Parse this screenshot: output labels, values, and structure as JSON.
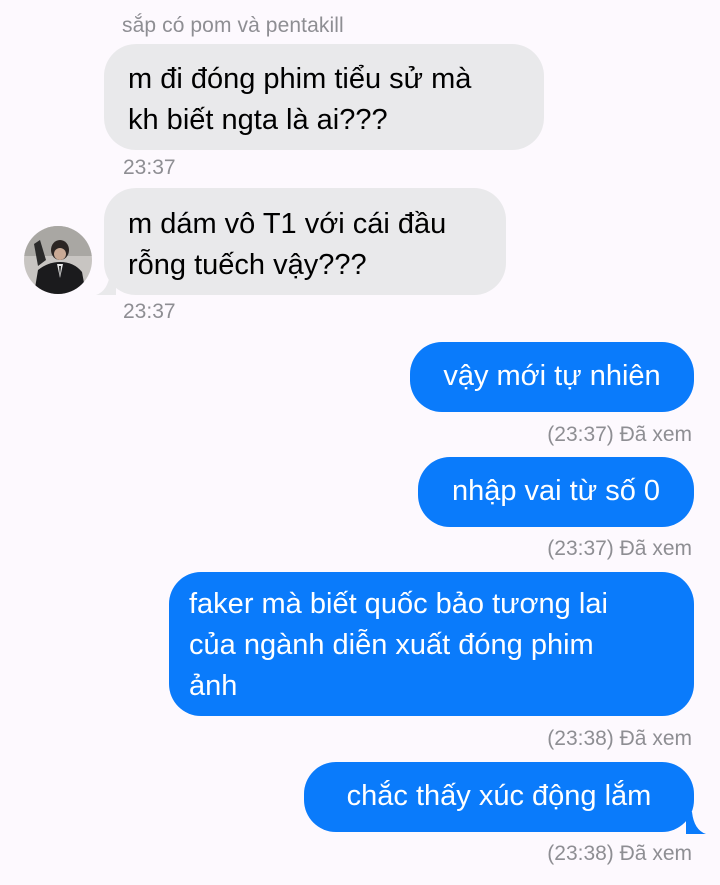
{
  "thread": {
    "sender_name": "sắp có pom và pentakill",
    "messages": [
      {
        "direction": "in",
        "text": "m đi đóng phim tiểu sử mà\nkh biết ngta là ai???",
        "time": "23:37"
      },
      {
        "direction": "in",
        "text": "m dám vô T1 với cái đầu\nrỗng tuếch vậy???",
        "time": "23:37"
      },
      {
        "direction": "out",
        "text": "vậy mới tự nhiên",
        "status": "(23:37) Đã xem"
      },
      {
        "direction": "out",
        "text": "nhập vai từ số 0",
        "status": "(23:37) Đã xem"
      },
      {
        "direction": "out",
        "text": "faker mà biết quốc bảo tương lai\ncủa ngành diễn xuất đóng phim\nảnh",
        "status": "(23:38) Đã xem"
      },
      {
        "direction": "out",
        "text": "chắc thấy xúc động lắm",
        "status": "(23:38) Đã xem"
      }
    ]
  },
  "colors": {
    "background": "#fdf9fe",
    "incoming_bubble": "#e9e9eb",
    "outgoing_bubble": "#0a7bfb",
    "meta_text": "#8e8e93"
  },
  "icons": {
    "avatar": "profile-photo"
  }
}
